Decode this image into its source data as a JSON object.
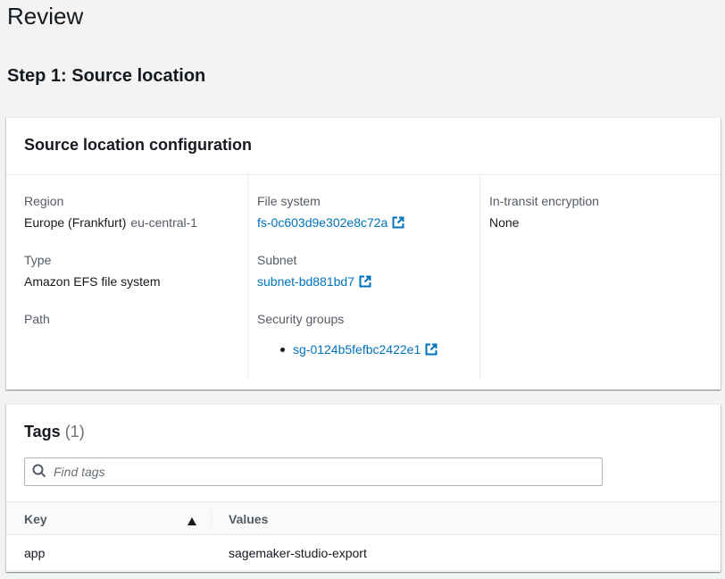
{
  "page": {
    "title": "Review"
  },
  "step": {
    "title": "Step 1: Source location"
  },
  "config": {
    "header": "Source location configuration",
    "region": {
      "label": "Region",
      "name": "Europe (Frankfurt)",
      "code": "eu-central-1"
    },
    "type": {
      "label": "Type",
      "value": "Amazon EFS file system"
    },
    "path": {
      "label": "Path"
    },
    "file_system": {
      "label": "File system",
      "value": "fs-0c603d9e302e8c72a"
    },
    "subnet": {
      "label": "Subnet",
      "value": "subnet-bd881bd7"
    },
    "security_groups": {
      "label": "Security groups",
      "items": [
        "sg-0124b5fefbc2422e1"
      ]
    },
    "encryption": {
      "label": "In-transit encryption",
      "value": "None"
    }
  },
  "tags": {
    "title": "Tags",
    "count": "(1)",
    "search_placeholder": "Find tags",
    "columns": {
      "key": "Key",
      "values": "Values"
    },
    "sort": {
      "column": "Key",
      "direction": "ascending"
    },
    "rows": [
      {
        "key": "app",
        "value": "sagemaker-studio-export"
      }
    ]
  },
  "colors": {
    "link": "#0073bb",
    "background": "#f2f3f3",
    "text": "#16191f",
    "muted": "#545b64"
  },
  "icons": {
    "external_link": "external-link-icon",
    "search": "search-icon",
    "sort": "sort-ascending-icon"
  }
}
